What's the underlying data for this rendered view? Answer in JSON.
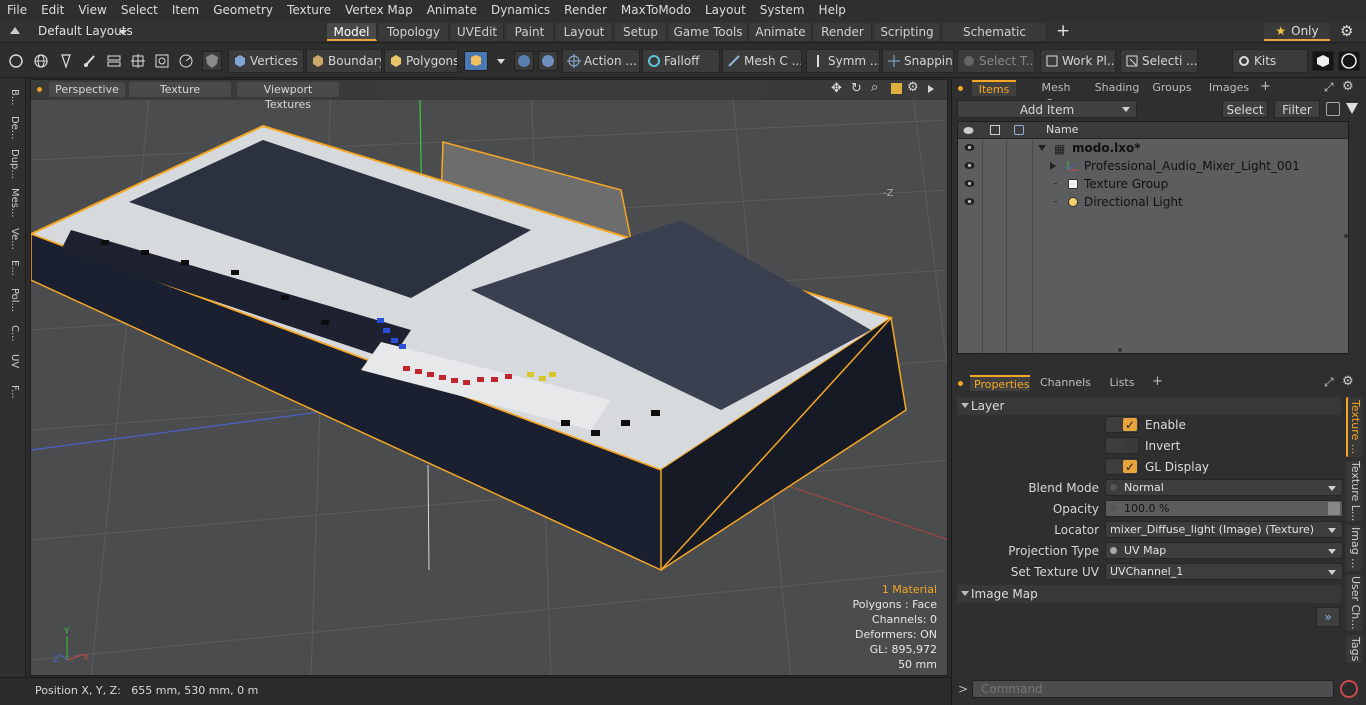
{
  "menu": [
    "File",
    "Edit",
    "View",
    "Select",
    "Item",
    "Geometry",
    "Texture",
    "Vertex Map",
    "Animate",
    "Dynamics",
    "Render",
    "MaxToModo",
    "Layout",
    "System",
    "Help"
  ],
  "layout_bar": {
    "layout_name": "Default Layouts",
    "tabs": [
      "Model",
      "Topology",
      "UVEdit",
      "Paint",
      "Layout",
      "Setup",
      "Game Tools",
      "Animate",
      "Render",
      "Scripting",
      "Schematic Fusion"
    ],
    "active_tab": "Model",
    "only_label": "Only"
  },
  "toolbar": {
    "vertices": "Vertices",
    "boundary": "Boundary",
    "polygons": "Polygons",
    "action": "Action ...",
    "falloff": "Falloff",
    "mesh": "Mesh C ...",
    "symmetry": "Symm ...",
    "snapping": "Snapping",
    "select_t": "Select T...",
    "work_plane": "Work Pl...",
    "selection": "Selecti ...",
    "kits": "Kits"
  },
  "left_strip": [
    "B...",
    "De...",
    "Dup...",
    "Mes...",
    "Ve...",
    "E...",
    "Pol...",
    "C...",
    "UV",
    "F..."
  ],
  "viewport": {
    "view_mode": "Perspective",
    "shading": "Texture",
    "textures": "Viewport Textures",
    "stats": {
      "material": "1 Material",
      "polygons": "Polygons : Face",
      "channels": "Channels: 0",
      "deformers": "Deformers: ON",
      "gl": "GL: 895,972",
      "size": "50 mm"
    },
    "axis_label": "-Z"
  },
  "status": {
    "position": "Position X, Y, Z:   655 mm, 530 mm, 0 m"
  },
  "items_panel": {
    "tabs": [
      "Items",
      "Mesh Ops",
      "Shading",
      "Groups",
      "Images"
    ],
    "active_tab": "Items",
    "add_item": "Add Item",
    "select": "Select",
    "filter": "Filter",
    "column_name": "Name",
    "items": [
      {
        "label": "modo.lxo*",
        "indent": 0
      },
      {
        "label": "Professional_Audio_Mixer_Light_001",
        "indent": 1
      },
      {
        "label": "Texture Group",
        "indent": 1
      },
      {
        "label": "Directional Light",
        "indent": 1
      }
    ]
  },
  "properties_panel": {
    "tabs": [
      "Properties",
      "Channels",
      "Lists"
    ],
    "active_tab": "Properties",
    "section_layer": "Layer",
    "enable": "Enable",
    "invert": "Invert",
    "gl_display": "GL Display",
    "blend_mode_label": "Blend Mode",
    "blend_mode": "Normal",
    "opacity_label": "Opacity",
    "opacity": "100.0 %",
    "locator_label": "Locator",
    "locator": "mixer_Diffuse_light (Image) (Texture)",
    "projection_label": "Projection Type",
    "projection": "UV Map",
    "set_uv_label": "Set Texture UV",
    "set_uv": "UVChannel_1",
    "section_image_map": "Image Map",
    "side_tabs": [
      "Texture ...",
      "Texture L...",
      "Imag ...",
      "User Ch...",
      "Tags"
    ]
  },
  "command": {
    "placeholder": "Command"
  },
  "colors": {
    "accent": "#f5a623",
    "viewport_bg": "#4a4c4e",
    "panel_bg": "#2f2f2f"
  }
}
